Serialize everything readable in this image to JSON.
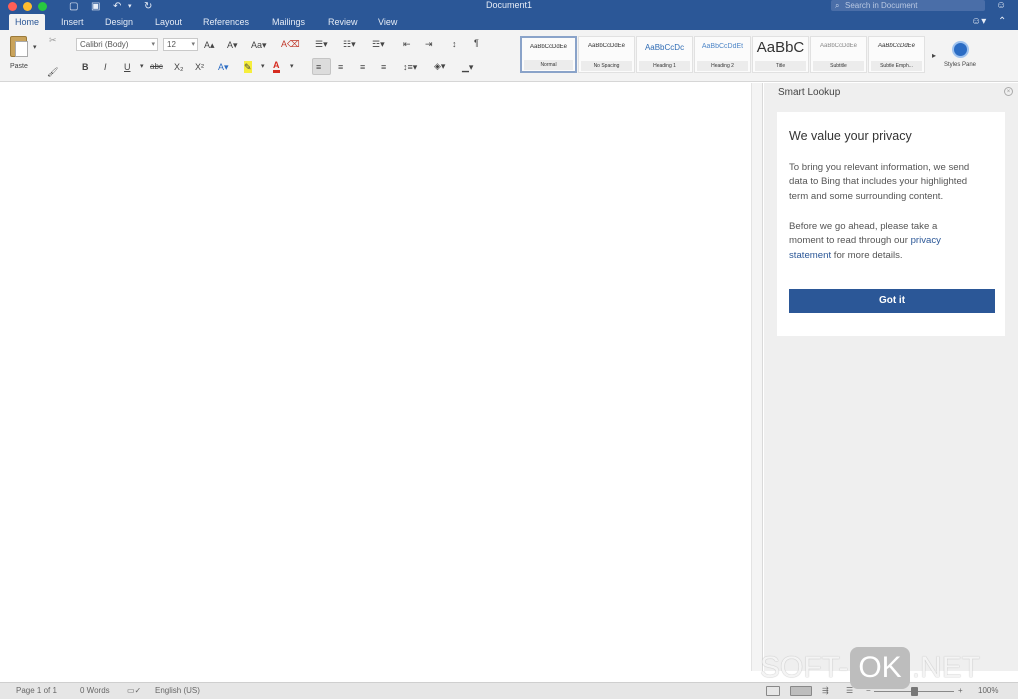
{
  "window": {
    "title": "Document1",
    "search_placeholder": "Search in Document"
  },
  "tabs": [
    "Home",
    "Insert",
    "Design",
    "Layout",
    "References",
    "Mailings",
    "Review",
    "View"
  ],
  "ribbon": {
    "paste_label": "Paste",
    "font_name": "Calibri (Body)",
    "font_size": "12",
    "styles": [
      {
        "preview": "AaBbCcDdEe",
        "name": "Normal"
      },
      {
        "preview": "AaBbCcDdEe",
        "name": "No Spacing"
      },
      {
        "preview": "AaBbCcDc",
        "name": "Heading 1"
      },
      {
        "preview": "AaBbCcDdEt",
        "name": "Heading 2"
      },
      {
        "preview": "AaBbC",
        "name": "Title"
      },
      {
        "preview": "AaBbCcDdEe",
        "name": "Subtitle"
      },
      {
        "preview": "AaBbCcDdEe",
        "name": "Subtle Emph..."
      }
    ],
    "styles_pane_label": "Styles Pane"
  },
  "smart_lookup": {
    "title": "Smart Lookup",
    "heading": "We value your privacy",
    "para1_lines": [
      "To bring you relevant information, we send",
      "data to Bing that includes your highlighted",
      "term and some surrounding content."
    ],
    "para2_line1": "Before we go ahead, please take a",
    "para2_line2_pre": "moment to read through our ",
    "para2_link1": "privacy",
    "para2_link2": "statement",
    "para2_line3_post": " for more details.",
    "button": "Got it"
  },
  "statusbar": {
    "page": "Page 1 of 1",
    "words": "0 Words",
    "language": "English (US)",
    "zoom": "100%"
  },
  "watermark": {
    "left": "SOFT-",
    "mid": "OK",
    "right": ".NET"
  },
  "colors": {
    "brand": "#2b5797",
    "ribbon": "#f3f3f3",
    "sidebar": "#efefef"
  }
}
